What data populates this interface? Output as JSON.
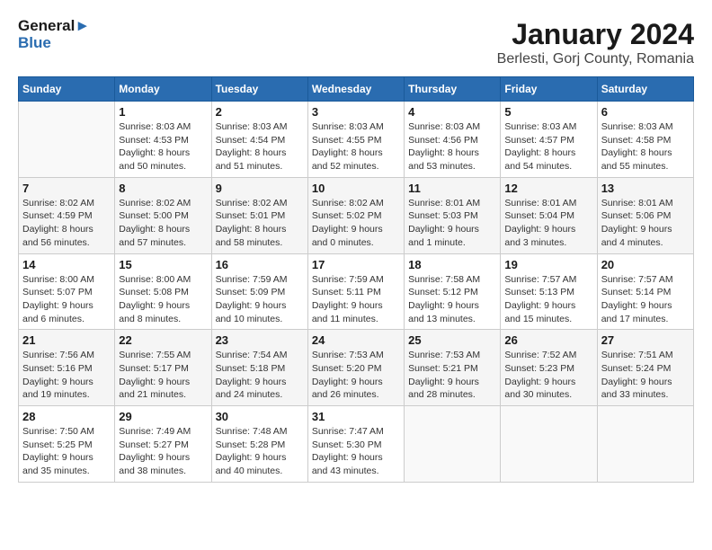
{
  "logo": {
    "text_general": "General",
    "text_blue": "Blue"
  },
  "title": "January 2024",
  "subtitle": "Berlesti, Gorj County, Romania",
  "header_days": [
    "Sunday",
    "Monday",
    "Tuesday",
    "Wednesday",
    "Thursday",
    "Friday",
    "Saturday"
  ],
  "weeks": [
    [
      {
        "day": "",
        "info": ""
      },
      {
        "day": "1",
        "info": "Sunrise: 8:03 AM\nSunset: 4:53 PM\nDaylight: 8 hours and 50 minutes."
      },
      {
        "day": "2",
        "info": "Sunrise: 8:03 AM\nSunset: 4:54 PM\nDaylight: 8 hours and 51 minutes."
      },
      {
        "day": "3",
        "info": "Sunrise: 8:03 AM\nSunset: 4:55 PM\nDaylight: 8 hours and 52 minutes."
      },
      {
        "day": "4",
        "info": "Sunrise: 8:03 AM\nSunset: 4:56 PM\nDaylight: 8 hours and 53 minutes."
      },
      {
        "day": "5",
        "info": "Sunrise: 8:03 AM\nSunset: 4:57 PM\nDaylight: 8 hours and 54 minutes."
      },
      {
        "day": "6",
        "info": "Sunrise: 8:03 AM\nSunset: 4:58 PM\nDaylight: 8 hours and 55 minutes."
      }
    ],
    [
      {
        "day": "7",
        "info": "Sunrise: 8:02 AM\nSunset: 4:59 PM\nDaylight: 8 hours and 56 minutes."
      },
      {
        "day": "8",
        "info": "Sunrise: 8:02 AM\nSunset: 5:00 PM\nDaylight: 8 hours and 57 minutes."
      },
      {
        "day": "9",
        "info": "Sunrise: 8:02 AM\nSunset: 5:01 PM\nDaylight: 8 hours and 58 minutes."
      },
      {
        "day": "10",
        "info": "Sunrise: 8:02 AM\nSunset: 5:02 PM\nDaylight: 9 hours and 0 minutes."
      },
      {
        "day": "11",
        "info": "Sunrise: 8:01 AM\nSunset: 5:03 PM\nDaylight: 9 hours and 1 minute."
      },
      {
        "day": "12",
        "info": "Sunrise: 8:01 AM\nSunset: 5:04 PM\nDaylight: 9 hours and 3 minutes."
      },
      {
        "day": "13",
        "info": "Sunrise: 8:01 AM\nSunset: 5:06 PM\nDaylight: 9 hours and 4 minutes."
      }
    ],
    [
      {
        "day": "14",
        "info": "Sunrise: 8:00 AM\nSunset: 5:07 PM\nDaylight: 9 hours and 6 minutes."
      },
      {
        "day": "15",
        "info": "Sunrise: 8:00 AM\nSunset: 5:08 PM\nDaylight: 9 hours and 8 minutes."
      },
      {
        "day": "16",
        "info": "Sunrise: 7:59 AM\nSunset: 5:09 PM\nDaylight: 9 hours and 10 minutes."
      },
      {
        "day": "17",
        "info": "Sunrise: 7:59 AM\nSunset: 5:11 PM\nDaylight: 9 hours and 11 minutes."
      },
      {
        "day": "18",
        "info": "Sunrise: 7:58 AM\nSunset: 5:12 PM\nDaylight: 9 hours and 13 minutes."
      },
      {
        "day": "19",
        "info": "Sunrise: 7:57 AM\nSunset: 5:13 PM\nDaylight: 9 hours and 15 minutes."
      },
      {
        "day": "20",
        "info": "Sunrise: 7:57 AM\nSunset: 5:14 PM\nDaylight: 9 hours and 17 minutes."
      }
    ],
    [
      {
        "day": "21",
        "info": "Sunrise: 7:56 AM\nSunset: 5:16 PM\nDaylight: 9 hours and 19 minutes."
      },
      {
        "day": "22",
        "info": "Sunrise: 7:55 AM\nSunset: 5:17 PM\nDaylight: 9 hours and 21 minutes."
      },
      {
        "day": "23",
        "info": "Sunrise: 7:54 AM\nSunset: 5:18 PM\nDaylight: 9 hours and 24 minutes."
      },
      {
        "day": "24",
        "info": "Sunrise: 7:53 AM\nSunset: 5:20 PM\nDaylight: 9 hours and 26 minutes."
      },
      {
        "day": "25",
        "info": "Sunrise: 7:53 AM\nSunset: 5:21 PM\nDaylight: 9 hours and 28 minutes."
      },
      {
        "day": "26",
        "info": "Sunrise: 7:52 AM\nSunset: 5:23 PM\nDaylight: 9 hours and 30 minutes."
      },
      {
        "day": "27",
        "info": "Sunrise: 7:51 AM\nSunset: 5:24 PM\nDaylight: 9 hours and 33 minutes."
      }
    ],
    [
      {
        "day": "28",
        "info": "Sunrise: 7:50 AM\nSunset: 5:25 PM\nDaylight: 9 hours and 35 minutes."
      },
      {
        "day": "29",
        "info": "Sunrise: 7:49 AM\nSunset: 5:27 PM\nDaylight: 9 hours and 38 minutes."
      },
      {
        "day": "30",
        "info": "Sunrise: 7:48 AM\nSunset: 5:28 PM\nDaylight: 9 hours and 40 minutes."
      },
      {
        "day": "31",
        "info": "Sunrise: 7:47 AM\nSunset: 5:30 PM\nDaylight: 9 hours and 43 minutes."
      },
      {
        "day": "",
        "info": ""
      },
      {
        "day": "",
        "info": ""
      },
      {
        "day": "",
        "info": ""
      }
    ]
  ]
}
